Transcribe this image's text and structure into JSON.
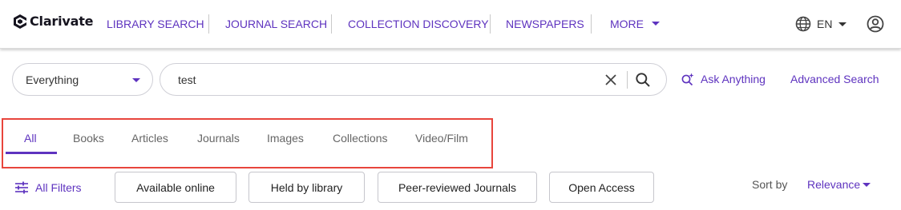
{
  "header": {
    "brand": "Clarivate",
    "nav": [
      "LIBRARY SEARCH",
      "JOURNAL SEARCH",
      "COLLECTION DISCOVERY",
      "NEWSPAPERS",
      "MORE"
    ],
    "language": "EN"
  },
  "search": {
    "scope": "Everything",
    "query": "test",
    "ask_label": "Ask Anything",
    "advanced_label": "Advanced Search"
  },
  "tabs": [
    "All",
    "Books",
    "Articles",
    "Journals",
    "Images",
    "Collections",
    "Video/Film"
  ],
  "active_tab": "All",
  "filters": {
    "all_filters_label": "All Filters",
    "chips": [
      "Available online",
      "Held by library",
      "Peer-reviewed Journals",
      "Open Access"
    ]
  },
  "sort": {
    "label": "Sort by",
    "value": "Relevance"
  },
  "colors": {
    "accent": "#5e33bf",
    "highlight_box": "#e8453c"
  }
}
